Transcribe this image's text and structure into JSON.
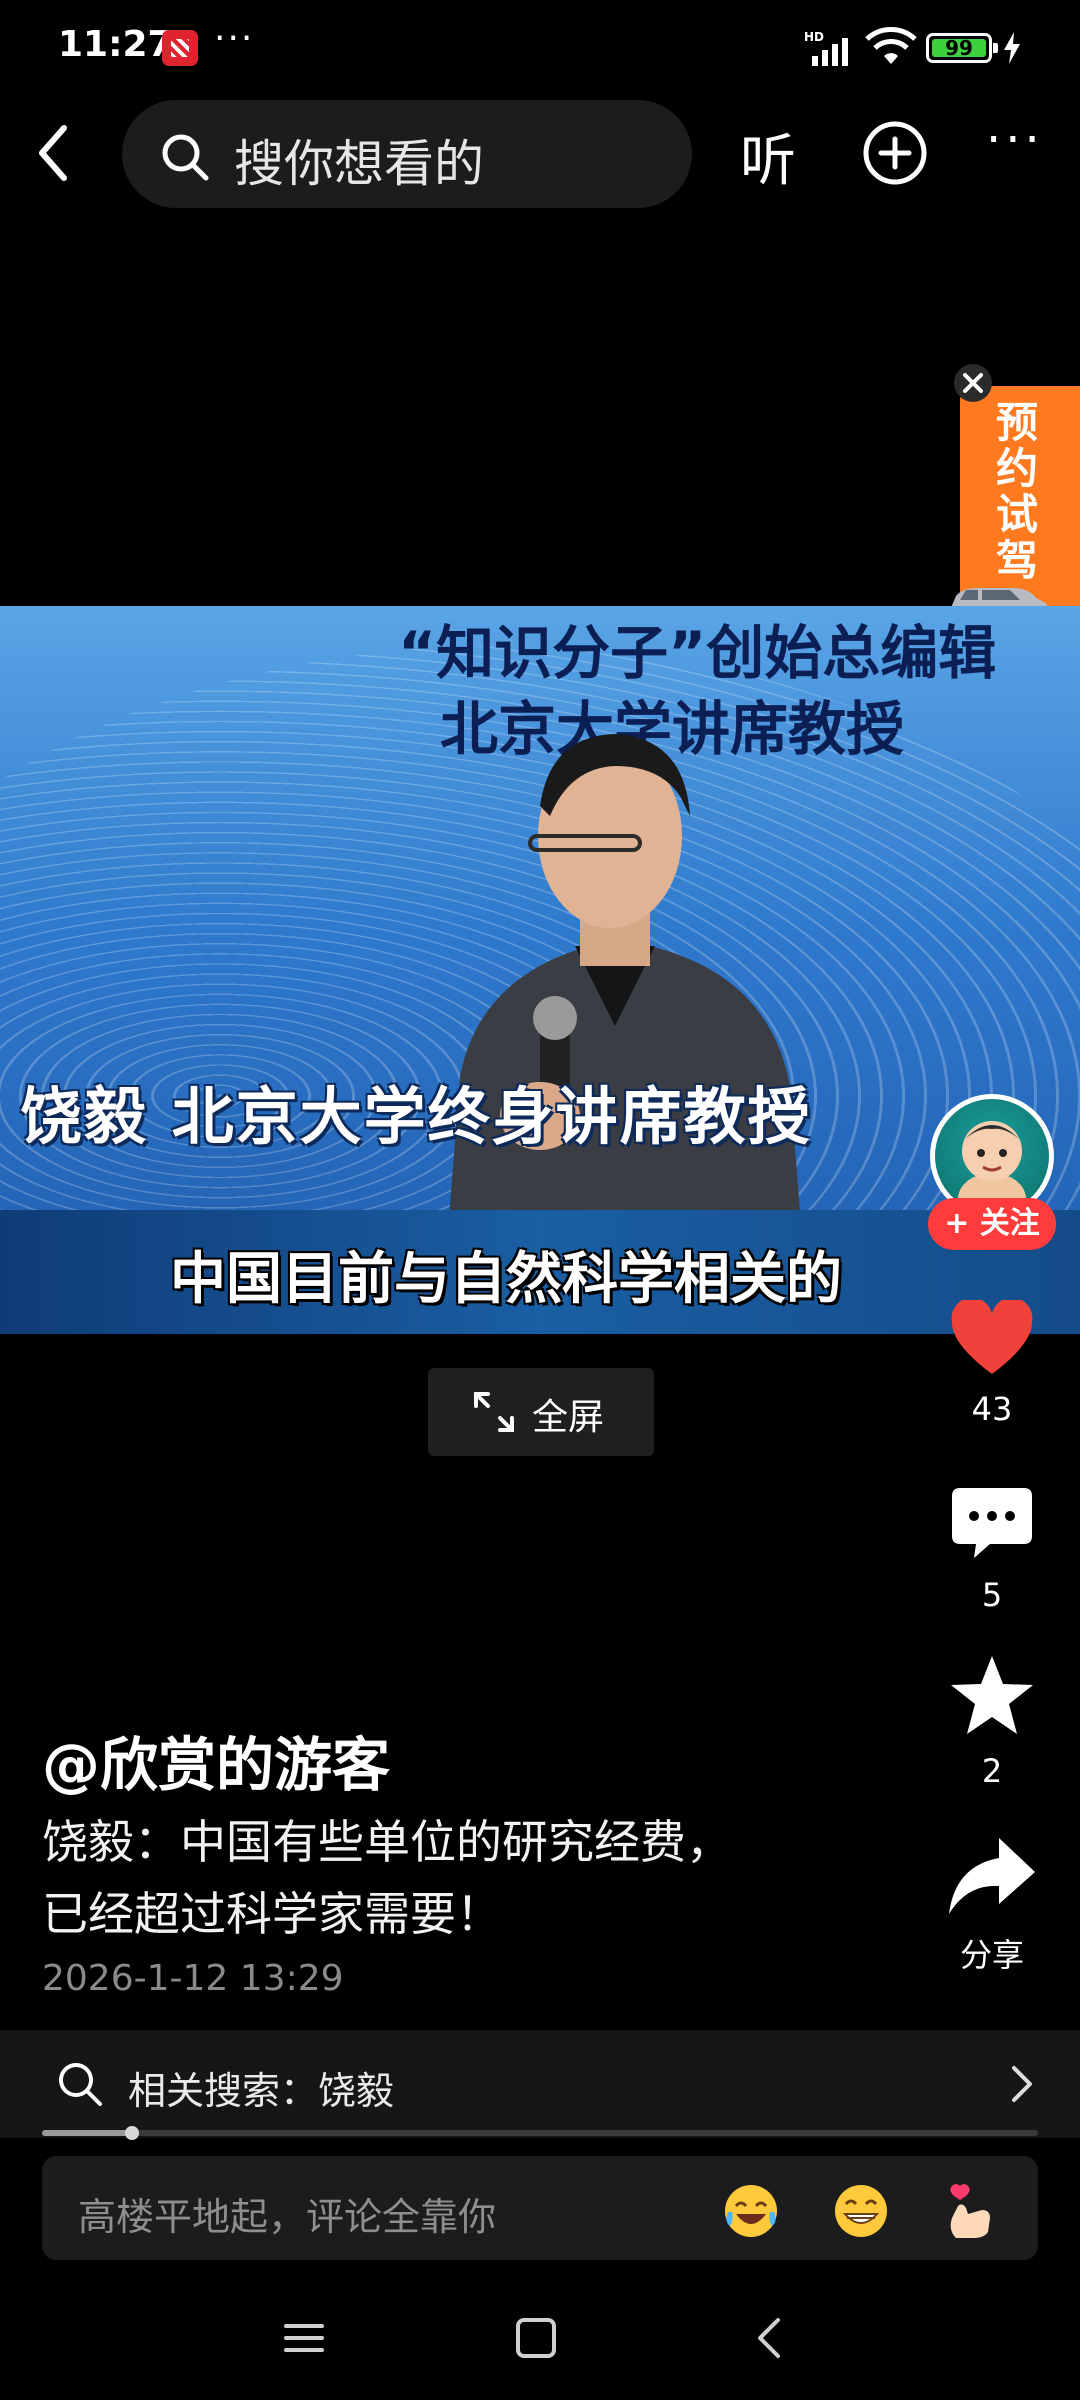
{
  "status_bar": {
    "time": "11:27",
    "overflow": "···",
    "network_label": "HD",
    "battery_level": "99",
    "icons": [
      "app-notification-icon",
      "signal-icon",
      "wifi-icon",
      "battery-icon",
      "charging-bolt-icon"
    ]
  },
  "top_nav": {
    "search_placeholder": "搜你想看的",
    "listen_label": "听",
    "more_label": "···",
    "icons": [
      "back-chevron-icon",
      "search-icon",
      "add-circle-icon"
    ]
  },
  "video": {
    "headline_line1": "“知识分子”创始总编辑",
    "headline_line2": "北京大学讲席教授",
    "lower_third": "饶毅 北京大学终身讲席教授",
    "caption": "中国目前与自然科学相关的",
    "fullscreen_label": "全屏"
  },
  "ad": {
    "label": "预约试驾",
    "accent_color": "#ff7a1f"
  },
  "actions": {
    "follow_label": "+ 关注",
    "likes": "43",
    "comments": "5",
    "favorites": "2",
    "share_label": "分享",
    "like_color": "#f0423b"
  },
  "post": {
    "author": "@欣赏的游客",
    "description_line1": "饶毅：中国有些单位的研究经费，",
    "description_line2": "已经超过科学家需要！",
    "timestamp": "2026-1-12 13:29"
  },
  "related_search": {
    "label": "相关搜索：饶毅"
  },
  "playback": {
    "progress": 0.09
  },
  "comment": {
    "placeholder": "高楼平地起，评论全靠你",
    "emojis": [
      "laughing-crying-emoji",
      "grinning-emoji",
      "finger-heart-emoji"
    ]
  },
  "system_nav": {
    "icons": [
      "menu-icon",
      "home-square-icon",
      "back-icon"
    ]
  }
}
